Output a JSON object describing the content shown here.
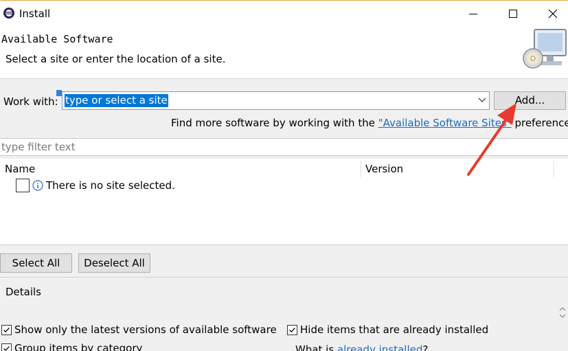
{
  "window": {
    "title": "Install"
  },
  "banner": {
    "title": "Available Software",
    "subtitle": "Select a site or enter the location of a site."
  },
  "work_with": {
    "label": "Work with:",
    "value": "type or select a site",
    "add_label": "Add..."
  },
  "find_more": {
    "prefix": "Find more software by working with the ",
    "link": "\"Available Software Sites\"",
    "suffix": " preferences."
  },
  "filter": {
    "placeholder": "type filter text"
  },
  "table": {
    "columns": [
      "Name",
      "Version"
    ],
    "rows": [
      {
        "text": "There is no site selected.",
        "checked": false
      }
    ]
  },
  "buttons": {
    "select_all": "Select All",
    "deselect_all": "Deselect All"
  },
  "details": {
    "label": "Details"
  },
  "options": [
    {
      "label": "Show only the latest versions of available software",
      "checked": true
    },
    {
      "label": "Hide items that are already installed",
      "checked": true
    },
    {
      "label": "Group items by category",
      "checked": true
    }
  ],
  "what_is": {
    "prefix": "What is ",
    "link": "already installed",
    "suffix": "?"
  },
  "colors": {
    "link": "#1c6cc1",
    "selection": "#0078d7",
    "annotation_arrow": "#e63b2e"
  },
  "icons": [
    "eclipse-icon",
    "minimize-icon",
    "maximize-icon",
    "close-icon",
    "install-banner-icon",
    "dropdown-arrow-icon",
    "info-icon",
    "spinner-icon"
  ]
}
